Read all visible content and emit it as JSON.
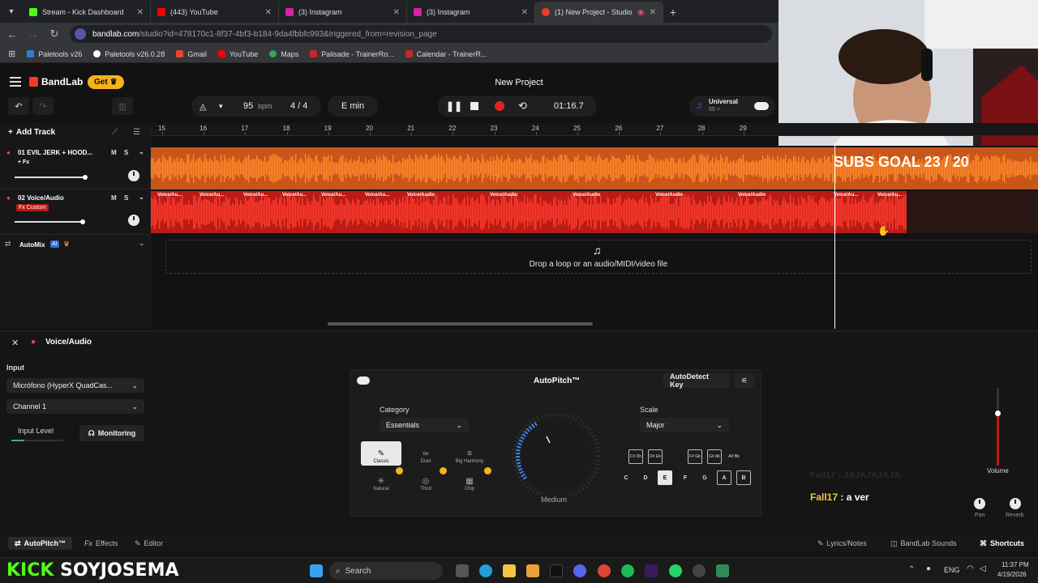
{
  "browser": {
    "tabs": [
      {
        "title": "Stream - Kick Dashboard",
        "color": "#53fc18"
      },
      {
        "title": "(443) YouTube",
        "color": "#ff0000"
      },
      {
        "title": "(3) Instagram",
        "color": "#d6249f"
      },
      {
        "title": "(3) Instagram",
        "color": "#d6249f"
      },
      {
        "title": "(1) New Project - Studio",
        "color": "#f23a2a"
      }
    ],
    "new_tab": "+",
    "url_host": "bandlab.com",
    "url_rest": "/studio?id=478170c1-8f37-4bf3-b184-9da4fbbfc993&triggered_from=revision_page",
    "bookmarks": [
      {
        "label": "Paletools v26",
        "color": "#2a7fd4"
      },
      {
        "label": "Paletools v26.0.28",
        "color": "#ffffff"
      },
      {
        "label": "Gmail",
        "color": "#ea4335"
      },
      {
        "label": "YouTube",
        "color": "#ff0000"
      },
      {
        "label": "Maps",
        "color": "#34a853"
      },
      {
        "label": "Palisade - TrainerRo...",
        "color": "#c62828"
      },
      {
        "label": "Calendar - TrainerR...",
        "color": "#c62828"
      }
    ]
  },
  "app": {
    "logo": "BandLab",
    "get_label": "Get",
    "project_title": "New Project",
    "tempo": "95",
    "tempo_unit": "bpm",
    "time_sig": "4 / 4",
    "key": "E min",
    "time": "01:16.7",
    "universal_title": "Universal",
    "universal_sub": "55 >",
    "add_track": "Add Track",
    "ruler": [
      "15",
      "16",
      "17",
      "18",
      "19",
      "20",
      "21",
      "22",
      "23",
      "24",
      "25",
      "26",
      "27",
      "28",
      "29"
    ],
    "tracks": [
      {
        "name": "01  EVIL JERK + HOOD...",
        "fx": "+ Fx",
        "mute": "M",
        "solo": "S",
        "volume": 0.7
      },
      {
        "name": "02  Voice/Audio",
        "fx": "Fx Custom",
        "mute": "M",
        "solo": "S",
        "volume": 0.66
      }
    ],
    "automix": "AutoMix",
    "automix_badge": "AI",
    "clip_label": "Voice/Au...",
    "clip_label_full": "Voice/Audio",
    "drop_text": "Drop a loop or an audio/MIDI/video file",
    "overlay_text": "SUBS GOAL 23 / 20"
  },
  "panel": {
    "track_title": "Voice/Audio",
    "input_label": "Input",
    "input_device": "Micrófono (HyperX QuadCas...",
    "channel": "Channel 1",
    "input_level_label": "Input Level",
    "monitoring": "Monitoring",
    "autopitch_title": "AutoPitch™",
    "autodetect": "AutoDetect Key",
    "category_label": "Category",
    "category_value": "Essentials",
    "presets": [
      {
        "label": "Classic",
        "icon": "✎"
      },
      {
        "label": "Duet",
        "icon": "∞"
      },
      {
        "label": "Big Harmony",
        "icon": "≡"
      },
      {
        "label": "Natural",
        "icon": "✳"
      },
      {
        "label": "Third",
        "icon": "◎"
      },
      {
        "label": "Chip",
        "icon": "▦"
      }
    ],
    "knob_label": "Medium",
    "scale_label": "Scale",
    "scale_value": "Major",
    "accidentals": [
      "C# Db",
      "D# Eb",
      "F# Gb",
      "G# Ab",
      "A# Bb"
    ],
    "notes": [
      "C",
      "D",
      "E",
      "F",
      "G",
      "A",
      "B"
    ],
    "volume_label": "Volume",
    "pan_label": "Pan",
    "reverb_label": "Reverb",
    "chat_line_faded": "Fall17 : JAJAJAJAJA",
    "chat_user": "Fall17",
    "chat_msg": " : a ver"
  },
  "footer": {
    "autopitch": "AutoPitch™",
    "effects": "Effects",
    "editor": "Editor",
    "lyrics": "Lyrics/Notes",
    "sounds": "BandLab Sounds",
    "shortcuts": "Shortcuts"
  },
  "taskbar": {
    "brand_kick": "KICK",
    "brand_user": "SOYJOSEMA",
    "search": "Search",
    "lang": "ENG",
    "time": "11:37 PM",
    "date": "4/19/2026"
  }
}
